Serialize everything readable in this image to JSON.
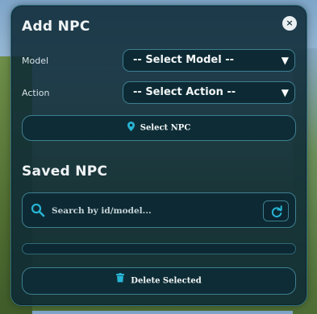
{
  "add_npc": {
    "title": "Add NPC",
    "close_label": "×",
    "model_label": "Model",
    "model_select_value": "-- Select Model --",
    "action_label": "Action",
    "action_select_value": "-- Select Action --",
    "select_npc_button": "Select NPC"
  },
  "saved_npc": {
    "title": "Saved NPC",
    "search_placeholder": "Search by id/model...",
    "delete_button": "Delete Selected"
  },
  "colors": {
    "accent": "#27b4d4",
    "panel_bg": "#0c2834",
    "border": "#3e7f90"
  },
  "icons": {
    "close": "close-icon",
    "pin": "map-pin-icon",
    "search": "search-icon",
    "refresh": "refresh-icon",
    "trash": "trash-icon",
    "chevron": "chevron-down-icon"
  }
}
